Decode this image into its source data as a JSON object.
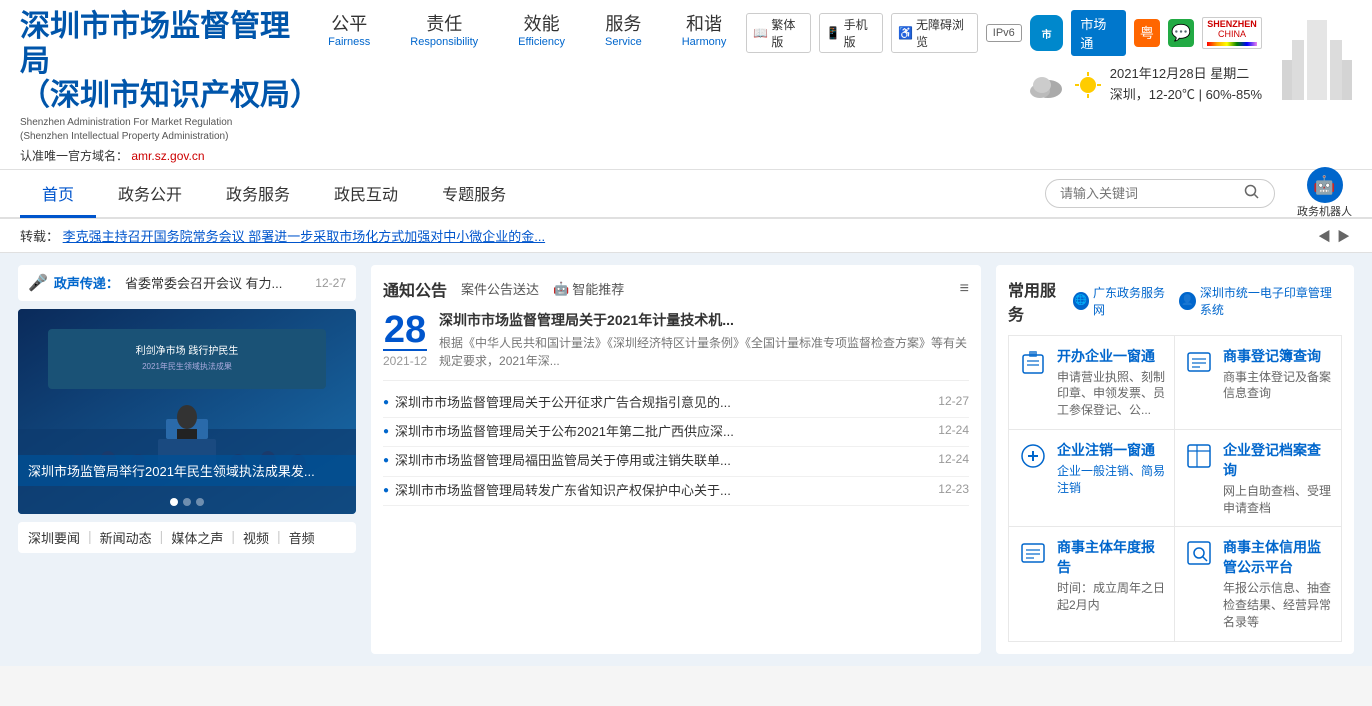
{
  "header": {
    "logo": {
      "title_line1": "深圳市市场监督管理局",
      "title_line2": "（深圳市知识产权局）",
      "en_line1": "Shenzhen Administration For Market Regulation",
      "en_line2": "(Shenzhen Intellectual Property Administration)",
      "domain_prefix": "认准唯一官方域名：",
      "domain": "amr.sz.gov.cn"
    },
    "tools": {
      "traditional": "繁体版",
      "mobile": "手机版",
      "accessibility": "无障碍浏览",
      "ipv6": "IPv6"
    },
    "social": {
      "market": "市场通",
      "gov": "粤",
      "wechat": "微信"
    },
    "weather": {
      "date": "2021年12月28日 星期二",
      "location": "深圳，12-20℃  | 60%-85%"
    },
    "slogan": [
      {
        "zh": "公平",
        "en": "Fairness"
      },
      {
        "zh": "责任",
        "en": "Responsibility"
      },
      {
        "zh": "效能",
        "en": "Efficiency"
      },
      {
        "zh": "服务",
        "en": "Service"
      },
      {
        "zh": "和谐",
        "en": "Harmony"
      }
    ]
  },
  "nav": {
    "items": [
      {
        "label": "首页",
        "active": true
      },
      {
        "label": "政务公开",
        "active": false
      },
      {
        "label": "政务服务",
        "active": false
      },
      {
        "label": "政民互动",
        "active": false
      },
      {
        "label": "专题服务",
        "active": false
      }
    ],
    "search_placeholder": "请输入关键词",
    "robot_label": "政务机器人"
  },
  "ticker": {
    "prefix": "转载：",
    "text": "李克强主持召开国务院常务会议 部署进一步采取市场化方式加强对中小微企业的金..."
  },
  "voice": {
    "label": "政声传递：",
    "text": "省委常委会召开会议 有力...",
    "date": "12-27"
  },
  "slideshow": {
    "caption": "深圳市场监管局举行2021年民生领域执法成果发...",
    "dots": [
      true,
      false,
      false
    ]
  },
  "bottom_links": [
    {
      "label": "深圳要闻"
    },
    {
      "label": "新闻动态"
    },
    {
      "label": "媒体之声"
    },
    {
      "label": "视频"
    },
    {
      "label": "音频"
    }
  ],
  "notice": {
    "title": "通知公告",
    "tabs": [
      {
        "label": "案件公告送达",
        "active": false
      },
      {
        "label": "🤖 智能推荐",
        "active": false
      }
    ],
    "featured": {
      "day": "28",
      "year_month": "2021-12",
      "title": "深圳市市场监督管理局关于2021年计量技术机...",
      "desc": "根据《中华人民共和国计量法》《深圳经济特区计量条例》《全国计量标准专项监督检查方案》等有关规定要求，2021年深..."
    },
    "items": [
      {
        "text": "深圳市市场监督管理局关于公开征求广告合规指引意见的...",
        "date": "12-27"
      },
      {
        "text": "深圳市市场监督管理局关于公布2021年第二批广西供应深...",
        "date": "12-24"
      },
      {
        "text": "深圳市市场监督管理局福田监管局关于停用或注销失联单...",
        "date": "12-24"
      },
      {
        "text": "深圳市市场监督管理局转发广东省知识产权保护中心关于...",
        "date": "12-23"
      }
    ]
  },
  "services": {
    "title": "常用服务",
    "external_links": [
      {
        "label": "广东政务服务网",
        "icon": "globe"
      },
      {
        "label": "深圳市统一电子印章管理系统",
        "icon": "person"
      }
    ],
    "items": [
      {
        "icon": "🏢",
        "name": "开办企业一窗通",
        "desc": "申请营业执照、刻制印章、申领发票、员工参保登记、公..."
      },
      {
        "icon": "📋",
        "name": "商事登记簿查询",
        "desc": "商事主体登记及备案信息查询"
      },
      {
        "icon": "🔌",
        "name": "企业注销一窗通",
        "desc_parts": [
          "企业一般注销、简易注销"
        ]
      },
      {
        "icon": "📁",
        "name": "企业登记档案查询",
        "desc": "网上自助查档、受理申请查档"
      },
      {
        "icon": "📊",
        "name": "商事主体年度报告",
        "desc": "时间：成立周年之日起2月内"
      },
      {
        "icon": "🔍",
        "name": "商事主体信用监管公示平台",
        "desc": "年报公示信息、抽查检查结果、经营异常名录等"
      }
    ]
  }
}
